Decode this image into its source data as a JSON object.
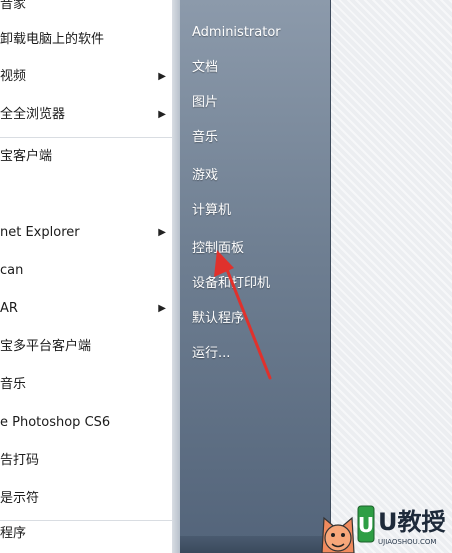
{
  "left_programs": [
    {
      "label": "音家",
      "has_submenu": false
    },
    {
      "label": "卸载电脑上的软件",
      "has_submenu": false
    },
    {
      "label": "视频",
      "has_submenu": true
    },
    {
      "label": "全全浏览器",
      "has_submenu": true
    },
    {
      "label": "宝客户端",
      "has_submenu": false
    },
    {
      "label": "net Explorer",
      "has_submenu": true
    },
    {
      "label": "can",
      "has_submenu": false
    },
    {
      "label": "AR",
      "has_submenu": true
    },
    {
      "label": "宝多平台客户端",
      "has_submenu": false
    },
    {
      "label": "音乐",
      "has_submenu": false
    },
    {
      "label": "e Photoshop CS6",
      "has_submenu": false
    },
    {
      "label": "告打码",
      "has_submenu": false
    },
    {
      "label": "是示符",
      "has_submenu": false
    }
  ],
  "all_programs_label": "程序",
  "right_items": [
    {
      "label": "Administrator"
    },
    {
      "label": "文档"
    },
    {
      "label": "图片"
    },
    {
      "label": "音乐"
    },
    {
      "label": "游戏"
    },
    {
      "label": "计算机"
    },
    {
      "label": "控制面板"
    },
    {
      "label": "设备和打印机"
    },
    {
      "label": "默认程序"
    },
    {
      "label": "运行..."
    }
  ],
  "watermark": {
    "title": "U教授",
    "url": "UJIAOSHOU.COM"
  },
  "colors": {
    "pane_top": "#8c9aab",
    "pane_bottom": "#53647a",
    "arrow": "#e0312c"
  }
}
